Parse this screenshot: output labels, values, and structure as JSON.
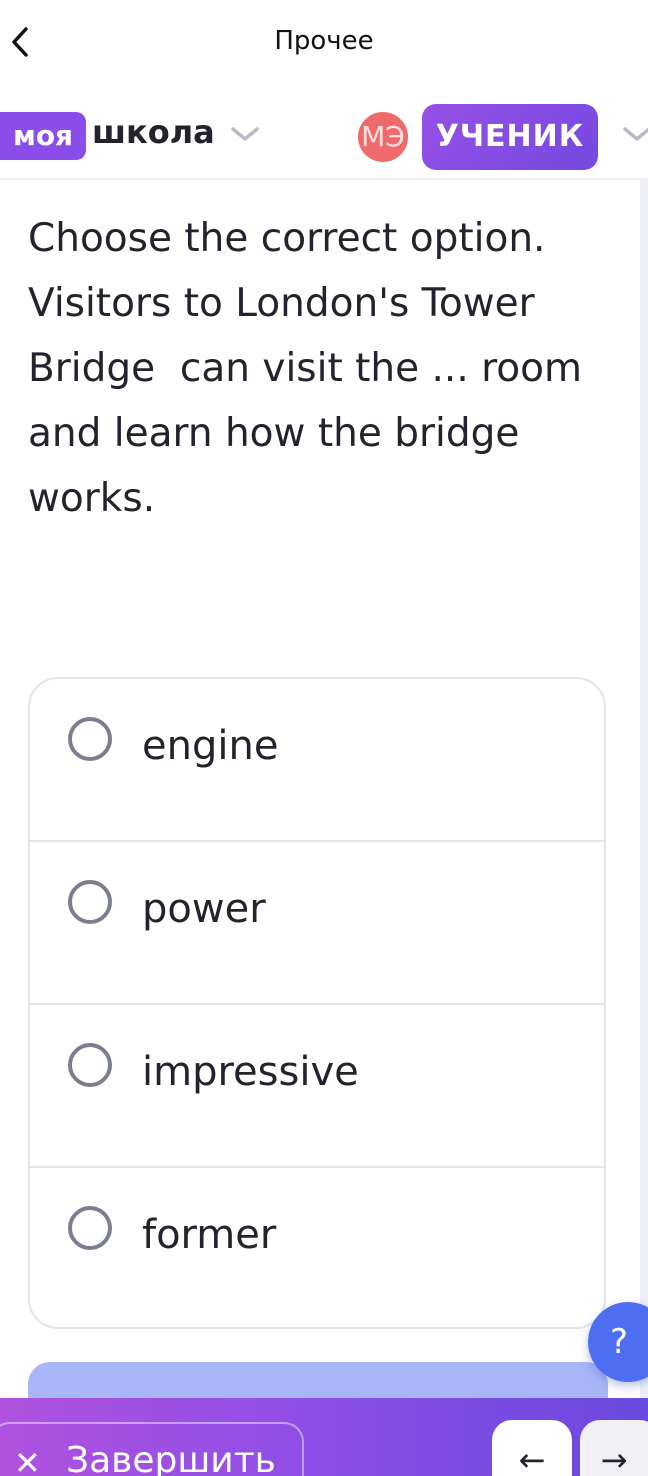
{
  "topbar": {
    "title": "Прочее"
  },
  "header": {
    "logo_badge": "моя",
    "logo_text": "школа",
    "avatar_initials": "МЭ",
    "role_label": "УЧЕНИК"
  },
  "question": {
    "text": "Choose the correct option.\nVisitors to London's Tower Bridge  can visit the ... room and learn how the bridge works."
  },
  "options": [
    {
      "label": "engine"
    },
    {
      "label": "power"
    },
    {
      "label": "impressive"
    },
    {
      "label": "former"
    }
  ],
  "help": {
    "label": "?"
  },
  "bottombar": {
    "finish_label": "Завершить",
    "prev_arrow": "←",
    "next_arrow": "→"
  },
  "colors": {
    "brand_purple": "#8a4dea",
    "help_blue": "#4d6ef0",
    "submit_blue": "#a8b6f8",
    "avatar_red": "#ef6a6a"
  },
  "icons": {
    "back": "chevron-left-icon",
    "dropdown": "chevron-down-icon",
    "close": "close-icon"
  }
}
